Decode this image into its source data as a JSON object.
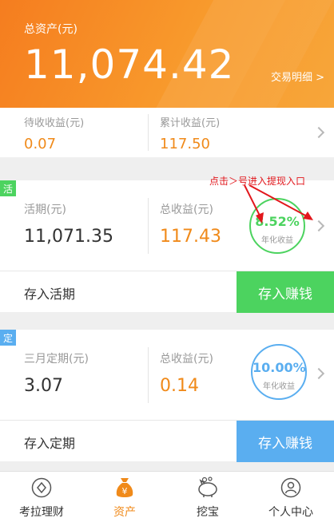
{
  "header": {
    "total_label": "总资产(元)",
    "total_value": "11,074.42",
    "transactions_link": "交易明细 >"
  },
  "summary": {
    "pending_label": "待收收益(元)",
    "pending_value": "0.07",
    "cumulative_label": "累计收益(元)",
    "cumulative_value": "117.50"
  },
  "annotation": "点击＞号进入提现入口",
  "current": {
    "badge": "活",
    "principal_label": "活期(元)",
    "principal_value": "11,071.35",
    "earnings_label": "总收益(元)",
    "earnings_value": "117.43",
    "rate": "8.52%",
    "rate_label": "年化收益",
    "deposit_label": "存入活期",
    "earn_label": "存入赚钱",
    "accent": "#4cd35f"
  },
  "fixed": {
    "badge": "定",
    "principal_label": "三月定期(元)",
    "principal_value": "3.07",
    "earnings_label": "总收益(元)",
    "earnings_value": "0.14",
    "rate": "10.00%",
    "rate_label": "年化收益",
    "deposit_label": "存入定期",
    "earn_label": "存入赚钱",
    "accent": "#5aaef0"
  },
  "tabs": [
    {
      "label": "考拉理财",
      "icon": "diamond-icon"
    },
    {
      "label": "资产",
      "icon": "money-bag-icon"
    },
    {
      "label": "挖宝",
      "icon": "piggy-bank-icon"
    },
    {
      "label": "个人中心",
      "icon": "person-icon"
    }
  ],
  "colors": {
    "orange": "#f08a1a",
    "annotation_red": "#e2171c"
  }
}
